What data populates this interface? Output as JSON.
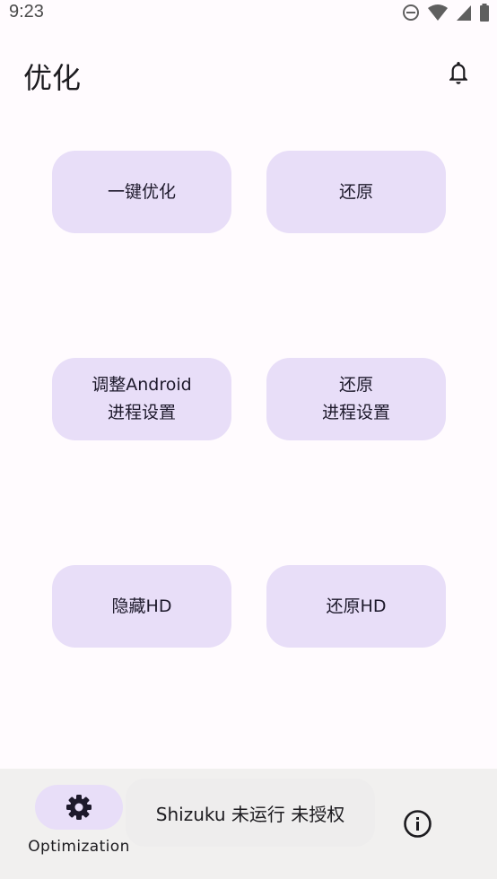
{
  "status_bar": {
    "time": "9:23"
  },
  "app_bar": {
    "title": "优化"
  },
  "buttons": {
    "one_click_optimize": "一键优化",
    "restore": "还原",
    "adjust_android_process": "调整Android\n进程设置",
    "restore_process": "还原\n进程设置",
    "hide_hd": "隐藏HD",
    "restore_hd": "还原HD"
  },
  "bottom_nav": {
    "optimization_label": "Optimization"
  },
  "toast": {
    "text": "Shizuku 未运行 未授权"
  },
  "colors": {
    "background": "#FFFBFE",
    "tile": "#E8DEF8",
    "nav_background": "#F1F0EF"
  }
}
